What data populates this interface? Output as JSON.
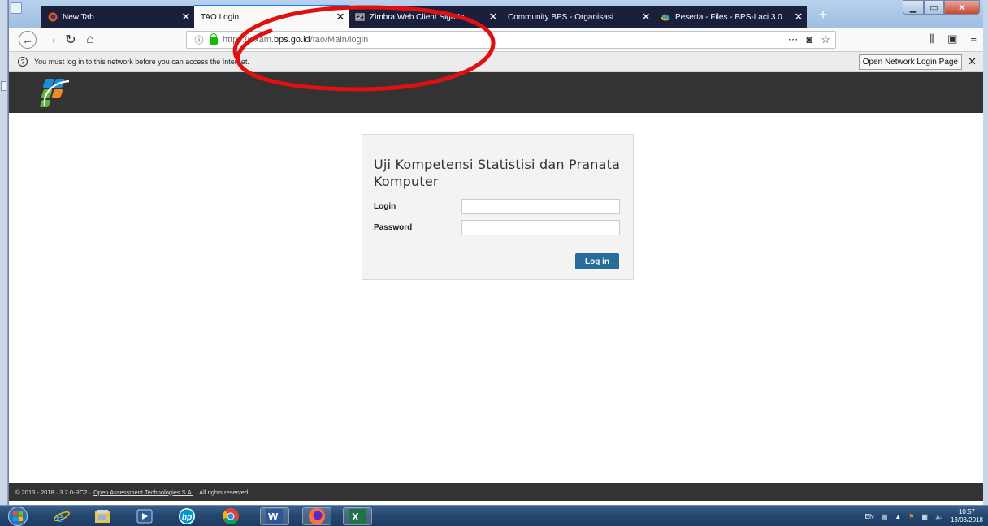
{
  "browser": {
    "tabs": [
      {
        "title": "New Tab",
        "favicon": "firefox-icon",
        "active": false
      },
      {
        "title": "TAO Login",
        "favicon": "",
        "active": true
      },
      {
        "title": "Zimbra Web Client Sign In",
        "favicon": "zimbra-icon",
        "active": false
      },
      {
        "title": "Community BPS - Organisasi",
        "favicon": "",
        "active": false
      },
      {
        "title": "Peserta - Files - BPS-Laci 3.0",
        "favicon": "cloud-icon",
        "active": false
      }
    ],
    "url": {
      "prefix": "https://exam.",
      "host": "bps.go.id",
      "path": "/tao/Main/login"
    },
    "notification": {
      "message": "You must log in to this network before you can access the Internet.",
      "button_label": "Open Network Login Page"
    }
  },
  "page": {
    "login": {
      "title": "Uji Kompetensi Statistisi dan Pranata Komputer",
      "login_label": "Login",
      "password_label": "Password",
      "login_value": "",
      "password_value": "",
      "submit_label": "Log in"
    },
    "footer": {
      "prefix": "© 2013 - 2018 · 3.2.0-RC2 ·",
      "company_link": "Open Assessment Technologies S.A.",
      "suffix": "· All rights reserved."
    }
  },
  "taskbar": {
    "language": "EN",
    "time": "10:57",
    "date": "13/03/2018"
  },
  "colors": {
    "annotation": "#e01010",
    "header_bg": "#333333",
    "login_button": "#266d9c"
  }
}
